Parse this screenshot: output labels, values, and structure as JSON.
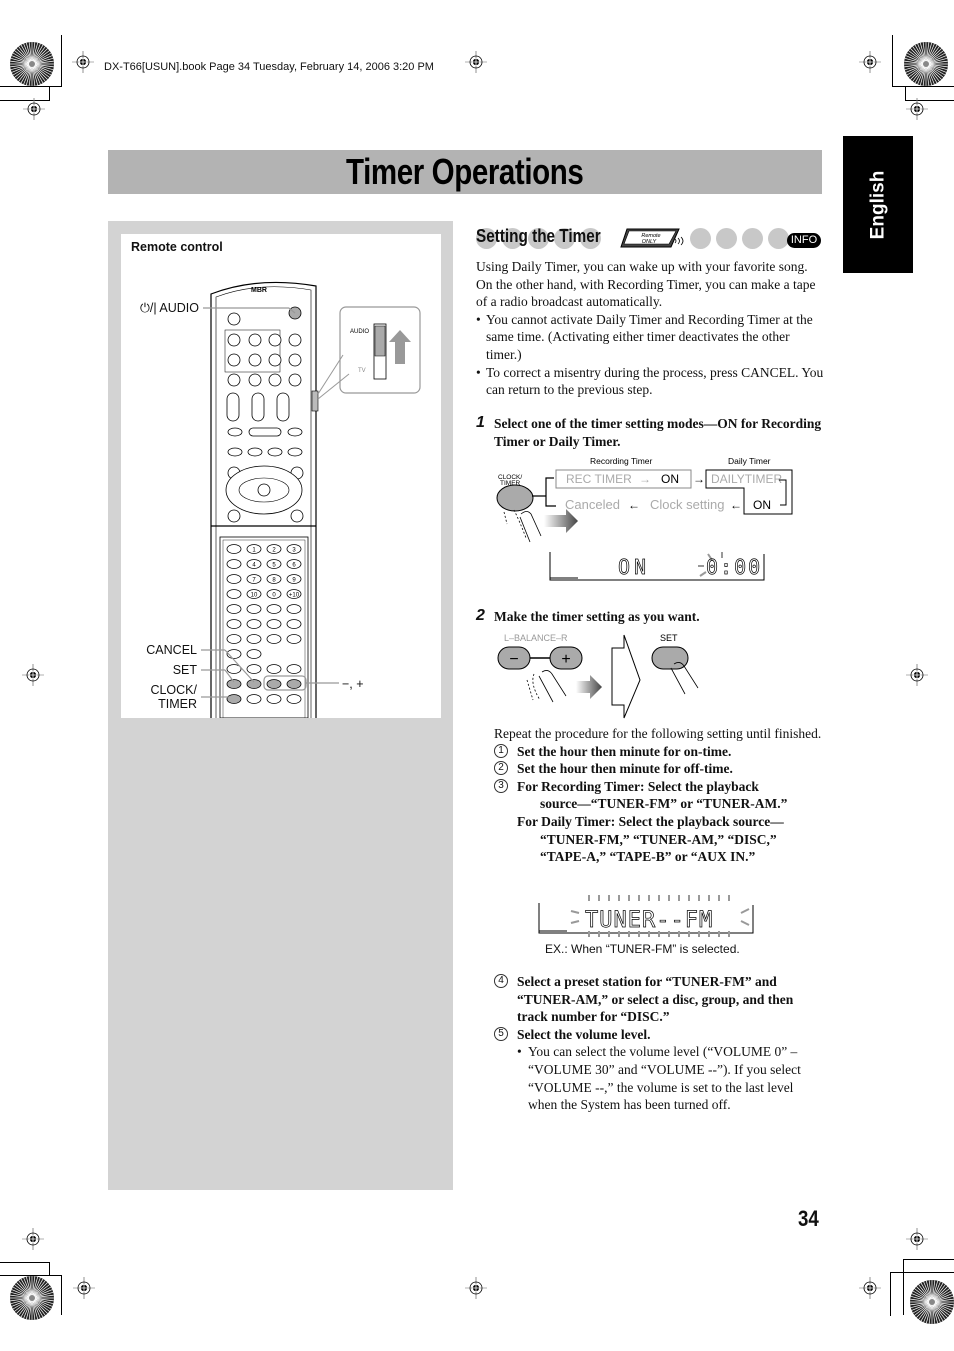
{
  "print_header": "DX-T66[USUN].book  Page 34  Tuesday, February 14, 2006  3:20 PM",
  "page_title": "Timer Operations",
  "language_tab": "English",
  "page_number": "34",
  "remote_panel": {
    "title": "Remote control",
    "brand_logo": "MBR",
    "callouts": {
      "power_audio": "⏻/| AUDIO",
      "cancel": "CANCEL",
      "set": "SET",
      "clock_timer_line1": "CLOCK/",
      "clock_timer_line2": "TIMER",
      "minus_plus": "−, +"
    },
    "switch_labels": {
      "audio": "AUDIO",
      "tv": "TV"
    },
    "number_keys": [
      "1",
      "2",
      "3",
      "4",
      "5",
      "6",
      "7",
      "8",
      "9",
      "10",
      "0",
      "+10"
    ]
  },
  "section": {
    "heading": "Setting the Timer",
    "remote_only_badge": {
      "line1": "Remote",
      "line2": "ONLY"
    },
    "info_badge": "INFO",
    "intro": "Using Daily Timer, you can wake up with your favorite song. On the other hand, with Recording Timer, you can make a tape of a radio broadcast automatically.",
    "bullets": [
      "You cannot activate Daily Timer and Recording Timer at the same time. (Activating either timer deactivates the other timer.)",
      "To correct a misentry during the process, press CANCEL. You can return to the previous step."
    ]
  },
  "step1": {
    "number": "1",
    "text": "Select one of the timer setting modes—ON for Recording Timer or Daily Timer.",
    "diagram": {
      "button_label_line1": "CLOCK/",
      "button_label_line2": "TIMER",
      "recording_timer_label": "Recording Timer",
      "daily_timer_label": "Daily Timer",
      "rec_timer": "REC TIMER",
      "on": "ON",
      "daily_timer": "DAILYTIMER",
      "daily_on": "ON",
      "canceled": "Canceled",
      "clock_setting": "Clock setting"
    },
    "lcd": {
      "mode": "ON",
      "time": "0:00"
    }
  },
  "step2": {
    "number": "2",
    "text": "Make the timer setting as you want.",
    "diagram": {
      "balance_label": "L–BALANCE–R",
      "minus": "−",
      "plus": "+",
      "set_label": "SET"
    },
    "repeat_text": "Repeat the procedure for the following setting until finished.",
    "items": [
      {
        "marker": "1",
        "lines": [
          "Set the hour then minute for on-time."
        ]
      },
      {
        "marker": "2",
        "lines": [
          "Set the hour then minute for off-time."
        ]
      },
      {
        "marker": "3",
        "lines": [
          "For Recording Timer: Select the playback",
          "source—“TUNER-FM” or “TUNER-AM.”"
        ],
        "extra_first": "For Daily Timer: Select the playback source—",
        "extra_rest": [
          "“TUNER-FM,” “TUNER-AM,” “DISC,”",
          "“TAPE-A,” “TAPE-B” or “AUX IN.”"
        ]
      }
    ],
    "lcd": {
      "text": "TUNER--FM",
      "caption": "EX.: When “TUNER-FM” is selected."
    },
    "items_after": [
      {
        "marker": "4",
        "text": "Select a preset station for “TUNER-FM” and “TUNER-AM,” or select a disc, group, and then track number for “DISC.”"
      },
      {
        "marker": "5",
        "text": "Select the volume level.",
        "note": "You can select the volume level (“VOLUME 0” – “VOLUME 30” and “VOLUME --”). If you select “VOLUME --,” the volume is set to the last level when the System has been turned off."
      }
    ]
  }
}
